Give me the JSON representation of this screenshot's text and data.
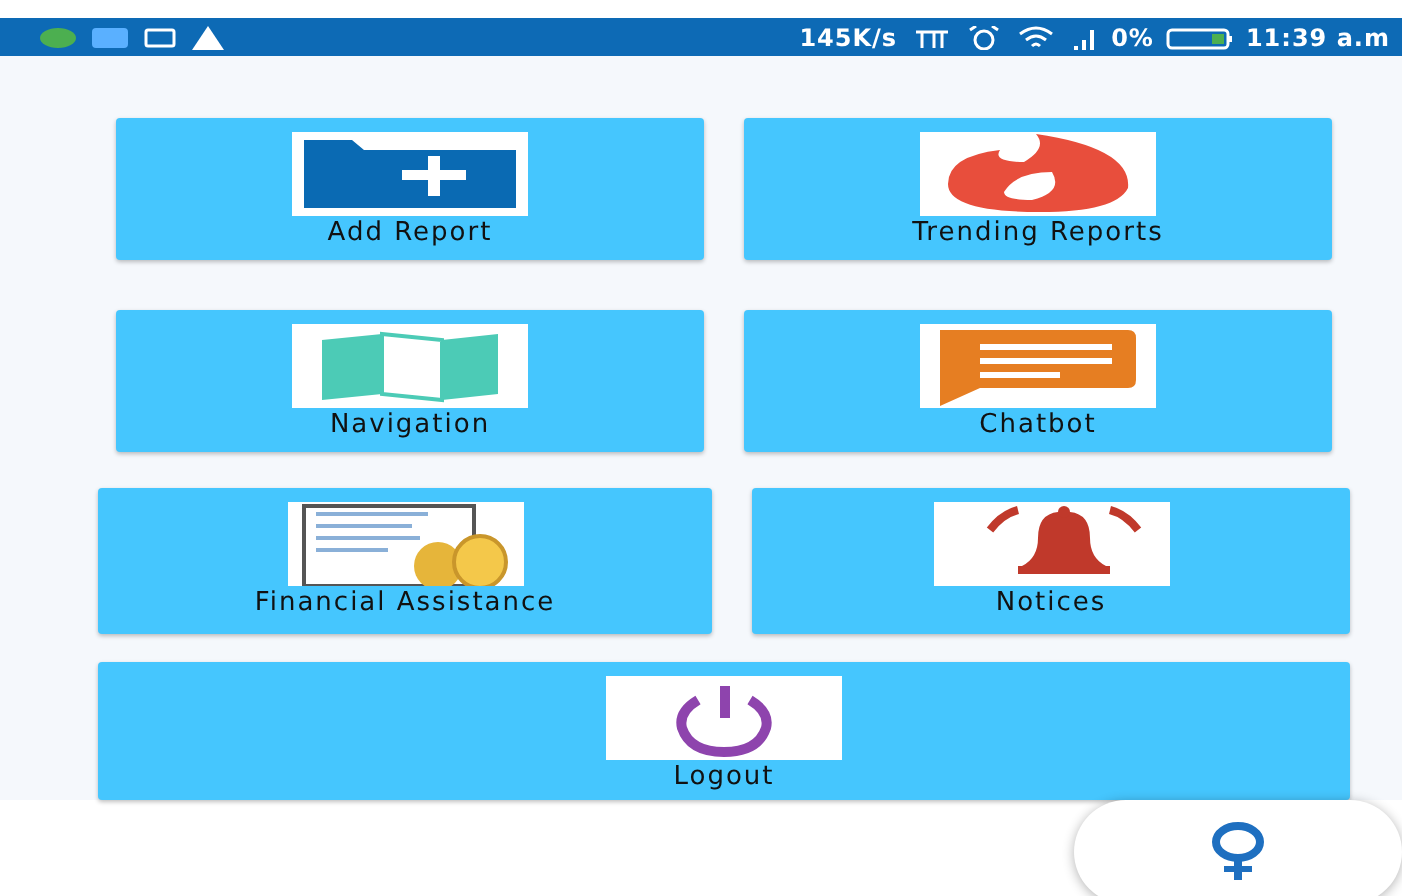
{
  "status_bar": {
    "network_speed": "145K/s",
    "battery": "0%",
    "time": "11:39 a.m"
  },
  "tiles": [
    {
      "label": "Add Report"
    },
    {
      "label": "Trending Reports"
    },
    {
      "label": "Navigation"
    },
    {
      "label": "Chatbot"
    },
    {
      "label": "Financial Assistance"
    },
    {
      "label": "Notices"
    },
    {
      "label": "Logout"
    }
  ]
}
